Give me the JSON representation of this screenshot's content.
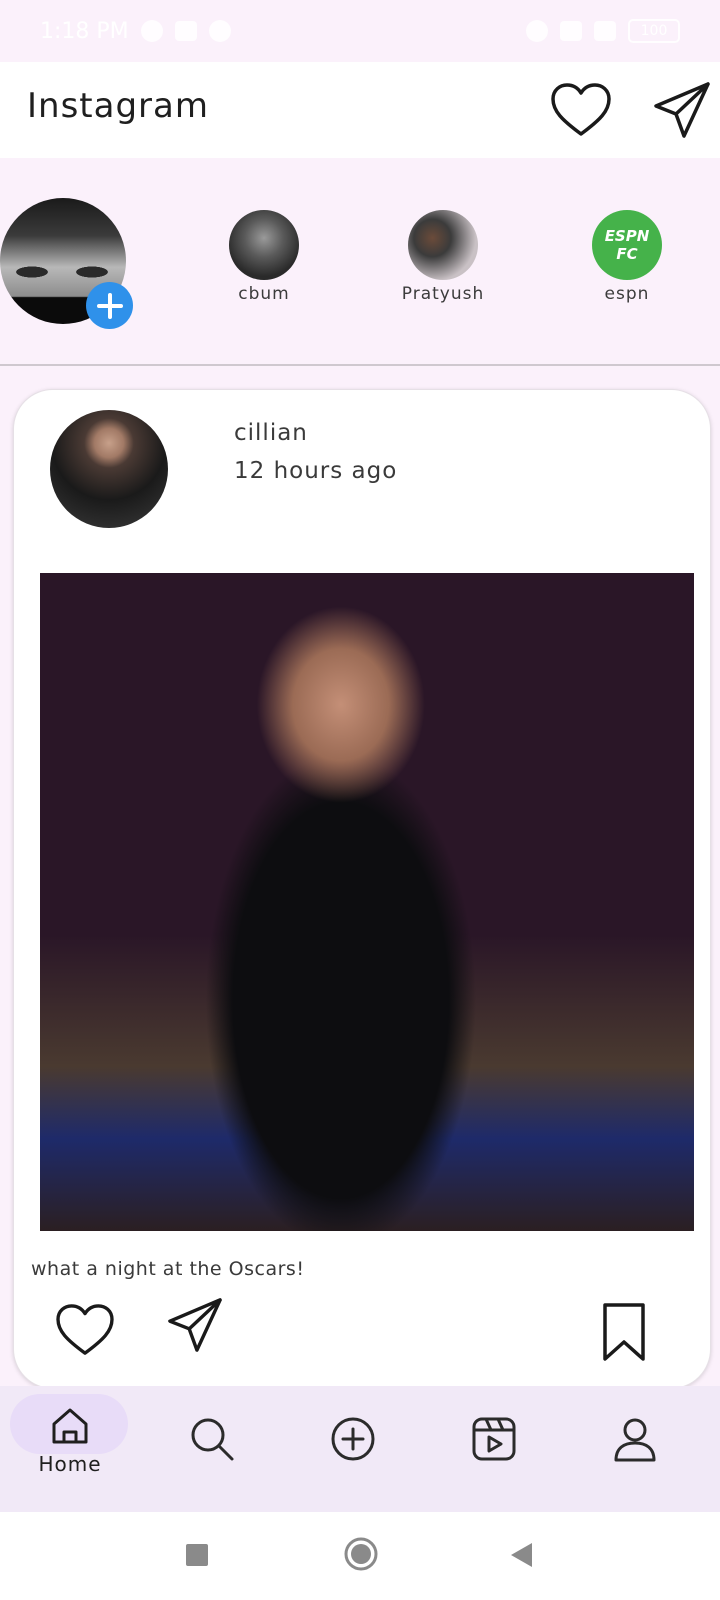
{
  "status_bar": {
    "time": "1:18 PM",
    "battery": "100"
  },
  "app_bar": {
    "title": "Instagram",
    "heart_icon": "heart-outline-icon",
    "send_icon": "paper-plane-icon"
  },
  "stories": {
    "items": [
      {
        "name": "cbum"
      },
      {
        "name": "Pratyush"
      },
      {
        "name": "espn",
        "logo_text": "ESPN FC"
      }
    ],
    "add_color": "#2f91ea"
  },
  "post": {
    "username": "cillian",
    "time": "12 hours ago",
    "caption": "what a night at the Oscars!"
  },
  "bottom_nav": {
    "items": [
      {
        "label": "Home",
        "icon": "home-icon",
        "selected": true
      },
      {
        "label": "",
        "icon": "search-icon"
      },
      {
        "label": "",
        "icon": "add-circle-icon"
      },
      {
        "label": "",
        "icon": "reels-icon"
      },
      {
        "label": "",
        "icon": "profile-icon"
      }
    ],
    "active_color": "#e8dcf8"
  },
  "system_nav": {
    "buttons": [
      "recents-icon",
      "home-circle-icon",
      "back-icon"
    ]
  }
}
